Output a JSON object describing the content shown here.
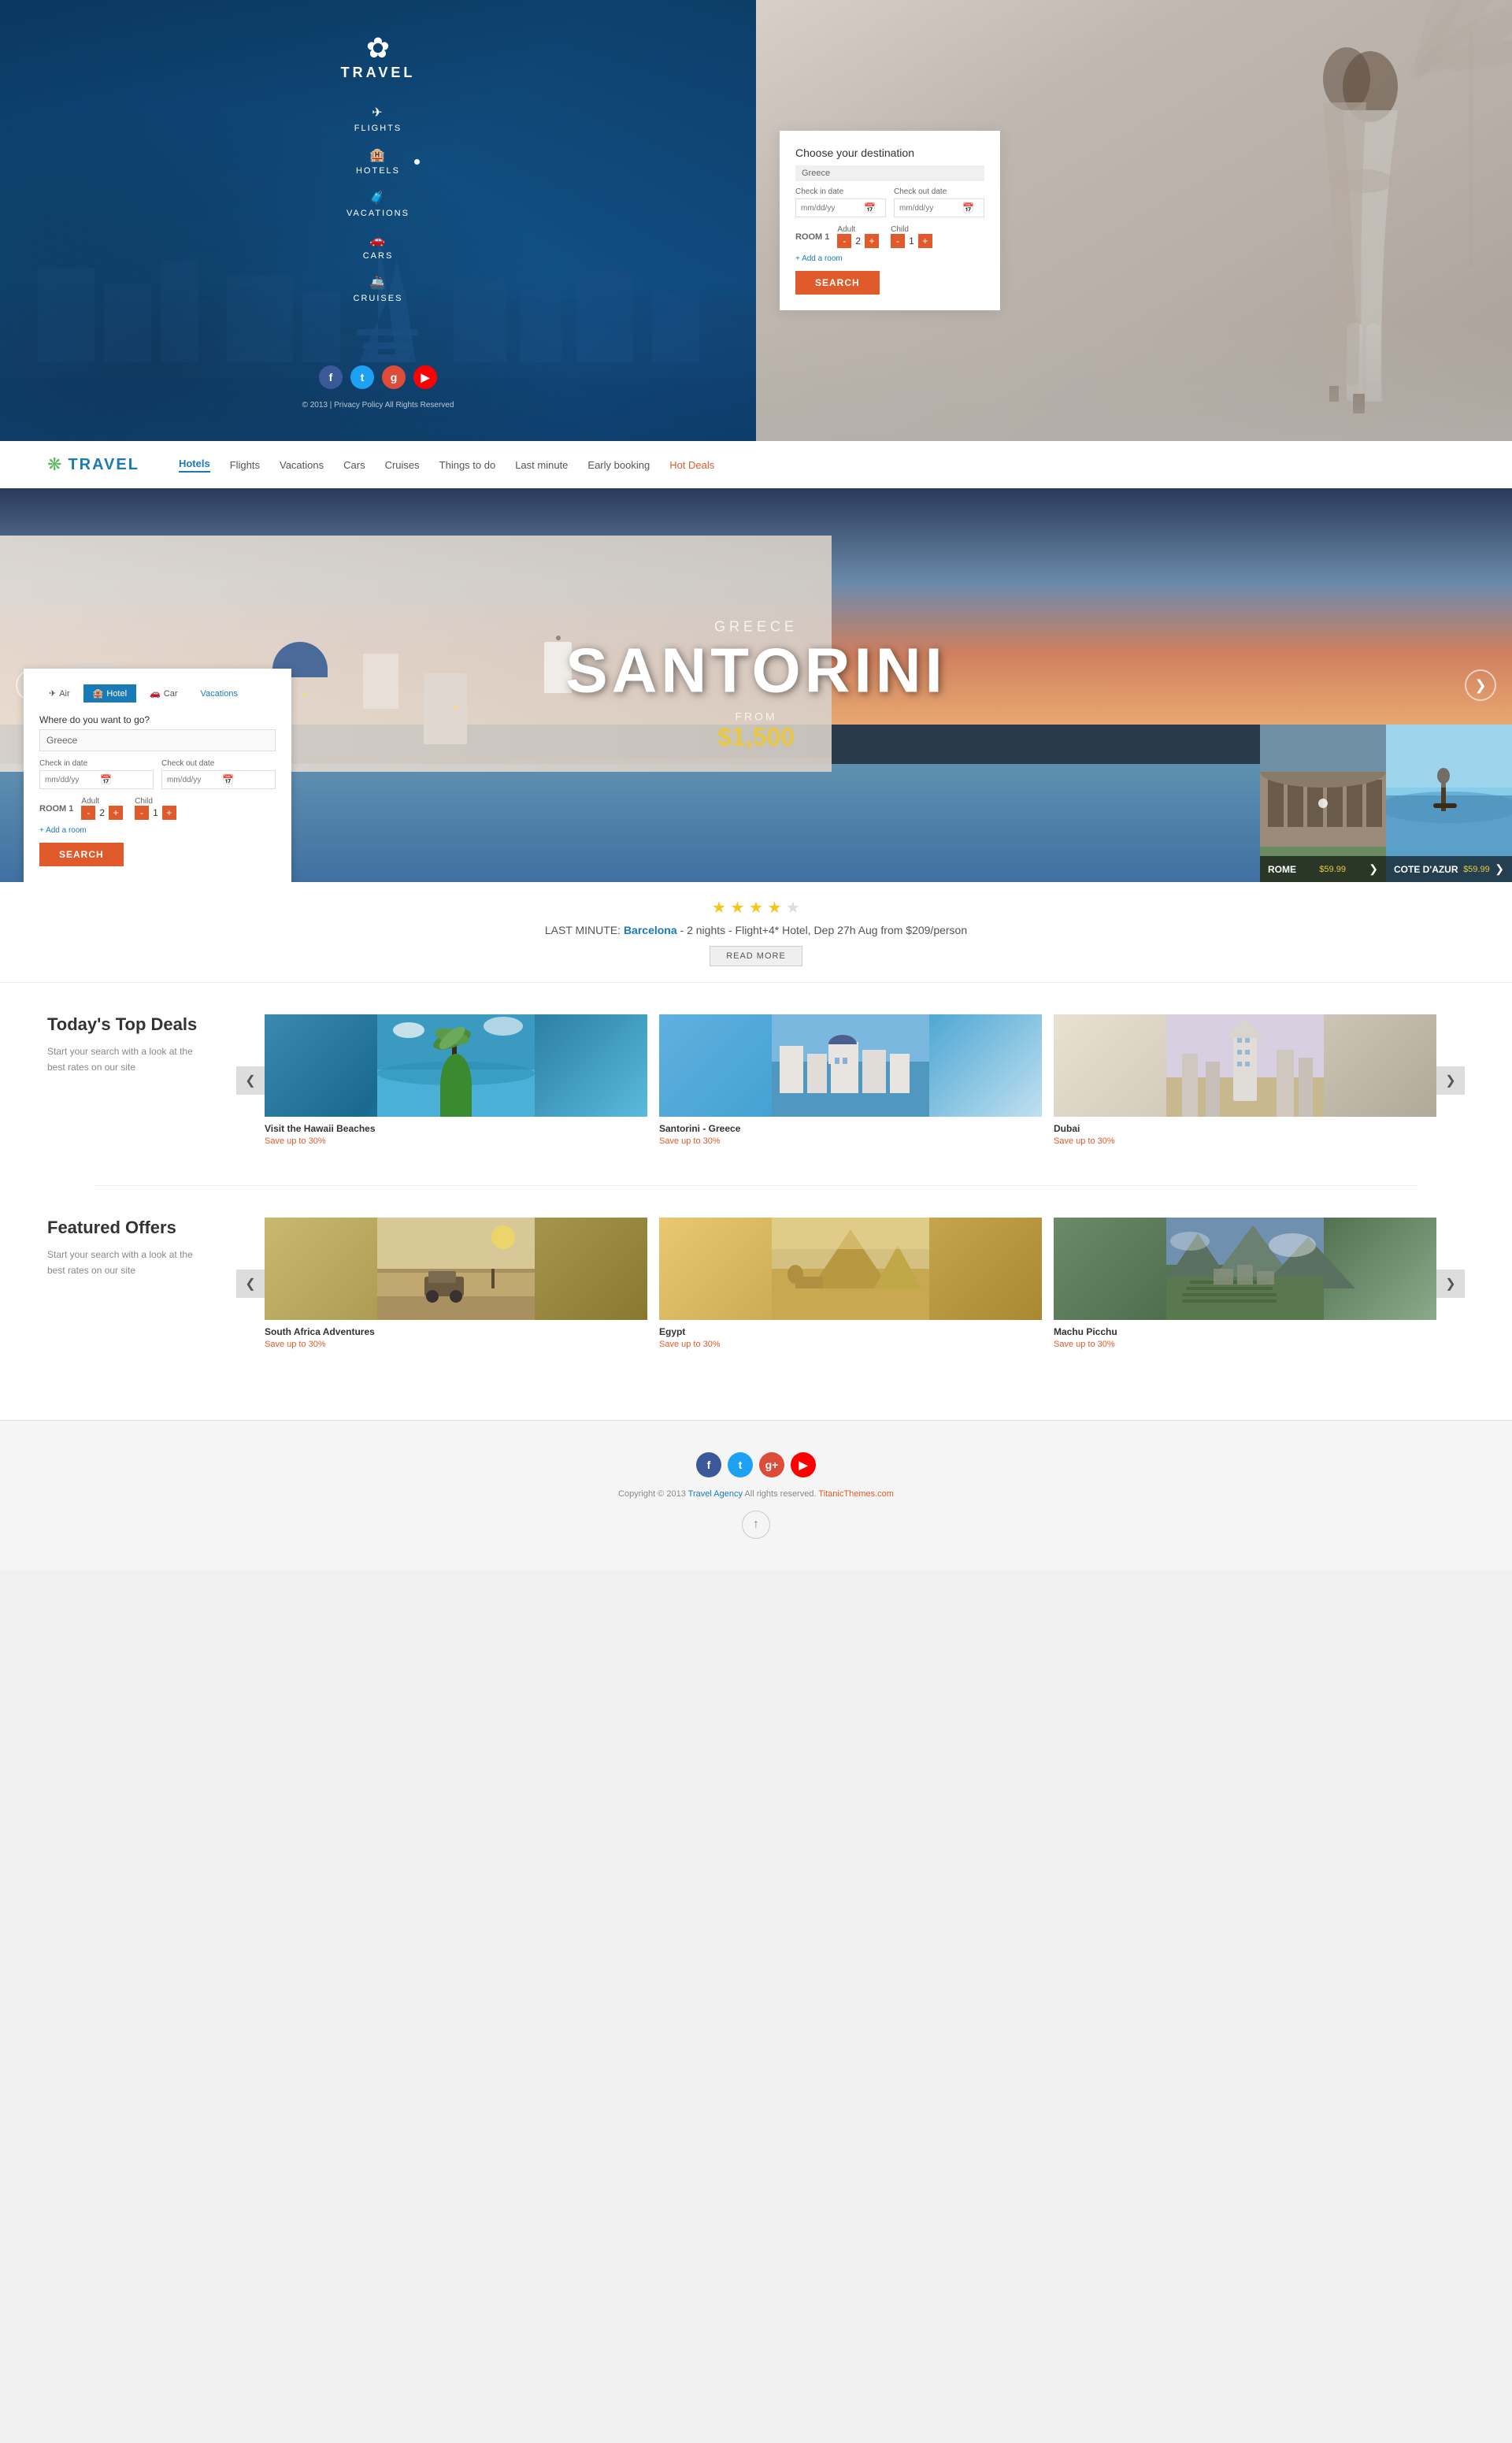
{
  "hero": {
    "logo": {
      "icon": "✿",
      "text": "TRAVEL"
    },
    "nav": [
      {
        "label": "FLIGHTS",
        "icon": "✈"
      },
      {
        "label": "HOTELS",
        "icon": "🏨"
      },
      {
        "label": "VACATIONS",
        "icon": "🧳"
      },
      {
        "label": "CARS",
        "icon": "🚗"
      },
      {
        "label": "CRUISES",
        "icon": "🚢"
      }
    ],
    "social": [
      {
        "label": "f",
        "type": "facebook"
      },
      {
        "label": "t",
        "type": "twitter"
      },
      {
        "label": "g",
        "type": "google"
      },
      {
        "label": "▶",
        "type": "youtube"
      }
    ],
    "footer": "© 2013  |  Privacy Policy\nAll Rights Reserved",
    "search": {
      "title": "Choose your destination",
      "destination_placeholder": "Greece",
      "checkin_label": "Check in date",
      "checkout_label": "Check out date",
      "checkin_placeholder": "mm/dd/yy",
      "checkout_placeholder": "mm/dd/yy",
      "room_label": "ROOM 1",
      "adult_label": "Adult",
      "child_label": "Child",
      "adult_count": "2",
      "child_count": "1",
      "add_room": "+ Add a room",
      "search_btn": "SEARCH"
    }
  },
  "navbar": {
    "logo_icon": "❋",
    "logo_text": "TRAVEL",
    "links": [
      {
        "label": "Hotels",
        "active": true
      },
      {
        "label": "Flights",
        "active": false
      },
      {
        "label": "Vacations",
        "active": false
      },
      {
        "label": "Cars",
        "active": false
      },
      {
        "label": "Cruises",
        "active": false
      },
      {
        "label": "Things to do",
        "active": false
      },
      {
        "label": "Last minute",
        "active": false
      },
      {
        "label": "Early booking",
        "active": false
      },
      {
        "label": "Hot Deals",
        "active": false,
        "hot": true
      }
    ]
  },
  "slider": {
    "subtitle": "GREECE",
    "title": "SANTORINI",
    "from_label": "FROM",
    "price": "$1,500",
    "arrow_left": "❮",
    "arrow_right": "❯",
    "destinations": [
      {
        "name": "ROME",
        "price": "$59.99"
      },
      {
        "name": "COTE D'AZUR",
        "price": "$59.99"
      }
    ],
    "search": {
      "tabs": [
        "Air",
        "Hotel",
        "Car",
        "Vacations"
      ],
      "active_tab": "Hotel",
      "destination_label": "Where do you want to go?",
      "destination_value": "Greece",
      "checkin_label": "Check in date",
      "checkout_label": "Check out date",
      "checkin_ph": "mm/dd/yy",
      "checkout_ph": "mm/dd/yy",
      "room_label": "ROOM 1",
      "adult_label": "Adult",
      "child_label": "Child",
      "adult_count": "2",
      "child_count": "1",
      "add_room": "+ Add a room",
      "search_btn": "SEARCH"
    }
  },
  "last_minute": {
    "stars": 4,
    "total_stars": 5,
    "text_prefix": "LAST MINUTE:",
    "destination": "Barcelona",
    "details": " - 2 nights - Flight+4* Hotel, Dep 27h Aug from $209/person",
    "read_more": "READ MORE"
  },
  "top_deals": {
    "title": "Today's Top\nDeals",
    "description": "Start your search with a look\nat the best rates on our site",
    "carousel_prev": "❮",
    "carousel_next": "❯",
    "items": [
      {
        "name": "Visit the Hawaii Beaches",
        "save": "Save up to 30%",
        "color": "#2a8ab0"
      },
      {
        "name": "Santorini - Greece",
        "save": "Save up to 30%",
        "color": "#40a8cc"
      },
      {
        "name": "Dubai",
        "save": "Save up to 30%",
        "color": "#c0b8a8"
      }
    ]
  },
  "featured_offers": {
    "title": "Featured\nOffers",
    "description": "Start your search with a look\nat the best rates on our site",
    "carousel_prev": "❮",
    "carousel_next": "❯",
    "items": [
      {
        "name": "South Africa Adventures",
        "save": "Save up to 30%",
        "color": "#a89040"
      },
      {
        "name": "Egypt",
        "save": "Save up to 30%",
        "color": "#c8a840"
      },
      {
        "name": "Machu Picchu",
        "save": "Save up to 30%",
        "color": "#5a8a5a"
      }
    ]
  },
  "footer": {
    "social": [
      {
        "label": "f",
        "color": "#3b5998"
      },
      {
        "label": "t",
        "color": "#1da1f2"
      },
      {
        "label": "g+",
        "color": "#dd4b39"
      },
      {
        "label": "▶",
        "color": "#ff0000"
      }
    ],
    "copyright_start": "Copyright © 2013 ",
    "agency": "Travel Agency",
    "copyright_mid": " All rights reserved. ",
    "titanic": "TitanicThemes.com",
    "scroll_top_icon": "↑"
  },
  "colors": {
    "primary_blue": "#1a7ab5",
    "accent_orange": "#e05a2b",
    "star_yellow": "#f5c518"
  }
}
